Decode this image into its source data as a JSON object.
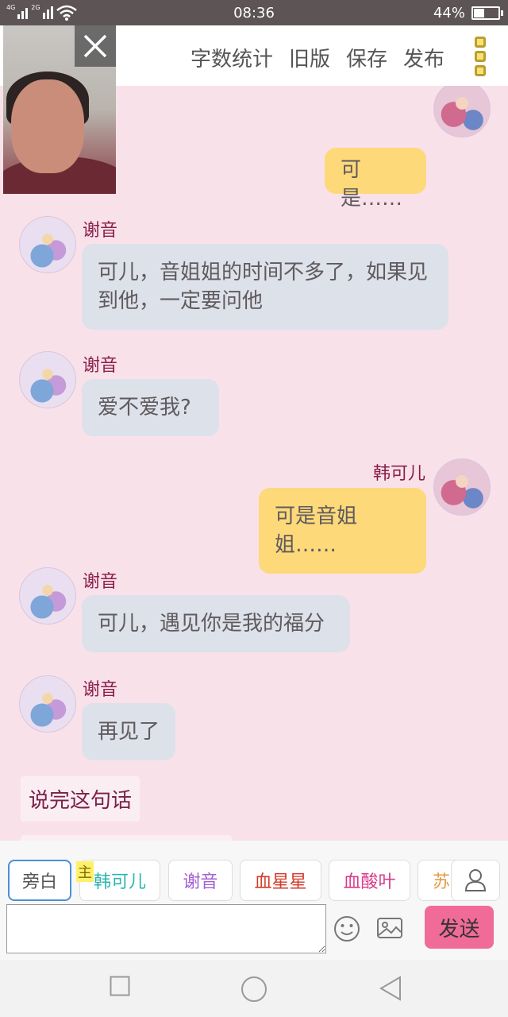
{
  "status_bar": {
    "network": "4G",
    "network2": "2G",
    "time": "08:36",
    "battery": "44%",
    "battery_level": 0.44
  },
  "toolbar": {
    "word_count": "字数统计",
    "old_version": "旧版",
    "save": "保存",
    "publish": "发布"
  },
  "messages": [
    {
      "side": "right",
      "speaker": "",
      "text": "可是……"
    },
    {
      "side": "left",
      "speaker": "谢音",
      "text": "可儿，音姐姐的时间不多了，如果见到他，一定要问他"
    },
    {
      "side": "left",
      "speaker": "谢音",
      "text": "爱不爱我?"
    },
    {
      "side": "right",
      "speaker": "韩可儿",
      "text": "可是音姐姐……"
    },
    {
      "side": "left",
      "speaker": "谢音",
      "text": "可儿，遇见你是我的福分"
    },
    {
      "side": "left",
      "speaker": "谢音",
      "text": "再见了"
    },
    {
      "side": "narration",
      "speaker": "",
      "text": "说完这句话"
    }
  ],
  "roles": {
    "main_tag": "主",
    "items": [
      {
        "label": "旁白",
        "color": "#555555"
      },
      {
        "label": "韩可儿",
        "color": "#2bb5b0"
      },
      {
        "label": "谢音",
        "color": "#a35fd0"
      },
      {
        "label": "血星星",
        "color": "#d23a2a"
      },
      {
        "label": "血酸叶",
        "color": "#d93a8a"
      },
      {
        "label": "苏",
        "color": "#e39a4a"
      }
    ]
  },
  "input": {
    "placeholder": "",
    "send": "发送"
  }
}
